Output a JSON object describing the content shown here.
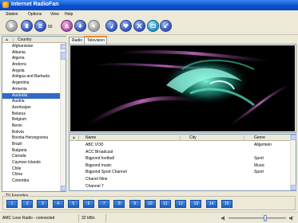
{
  "window": {
    "title": "Internet RadioFan"
  },
  "menu": [
    "Station",
    "Options",
    "View",
    "Help"
  ],
  "toolbar": {
    "volume_value": "60",
    "buttons": [
      "play",
      "stop",
      "record",
      "schedule",
      "eject",
      "volume",
      "sound",
      "favorites",
      "settings",
      "info",
      "minimize"
    ]
  },
  "countries": {
    "header": "Country",
    "items": [
      "Afghanistan",
      "Albania",
      "Algeria",
      "Andorra",
      "Angola",
      "Antigua and Barbuda",
      "Argentina",
      "Armenia",
      "Australia",
      "Austria",
      "Azerbaijan",
      "Belarus",
      "Belgium",
      "Benin",
      "Bolivia",
      "Bosnia-Herzegovina",
      "Brazil",
      "Bulgaria",
      "Canada",
      "Cayman Islands",
      "Chile",
      "China",
      "Colombia"
    ],
    "selected": "Australia"
  },
  "tabs": [
    "Radio",
    "Television"
  ],
  "active_tab": "Television",
  "channels": {
    "columns": [
      "Name",
      "City",
      "Genre"
    ],
    "rows": [
      {
        "name": "ABC VOD",
        "city": "",
        "genre": "Allgemein"
      },
      {
        "name": "ACC Broadcast",
        "city": "",
        "genre": ""
      },
      {
        "name": "Bigpond football",
        "city": "",
        "genre": "Sport"
      },
      {
        "name": "Bigpond music",
        "city": "",
        "genre": "Music"
      },
      {
        "name": "Bigpond Sport Channel",
        "city": "",
        "genre": "Sport"
      },
      {
        "name": "Chanel Nine",
        "city": "",
        "genre": ""
      },
      {
        "name": "Channel 7",
        "city": "",
        "genre": ""
      }
    ]
  },
  "favorites": {
    "label": "TV Favorites",
    "buttons": [
      "1",
      "2",
      "3",
      "4",
      "5",
      "6",
      "7",
      "8",
      "9",
      "10",
      "11",
      "12",
      "13",
      "14",
      "15"
    ]
  },
  "status": {
    "text": "AMC Love Radio - connected",
    "bitrate": "32 kB/s"
  },
  "colors": {
    "selection": "#316ac5",
    "titlebar": "#0a4fd0",
    "tab_highlight": "#e68b2c"
  }
}
